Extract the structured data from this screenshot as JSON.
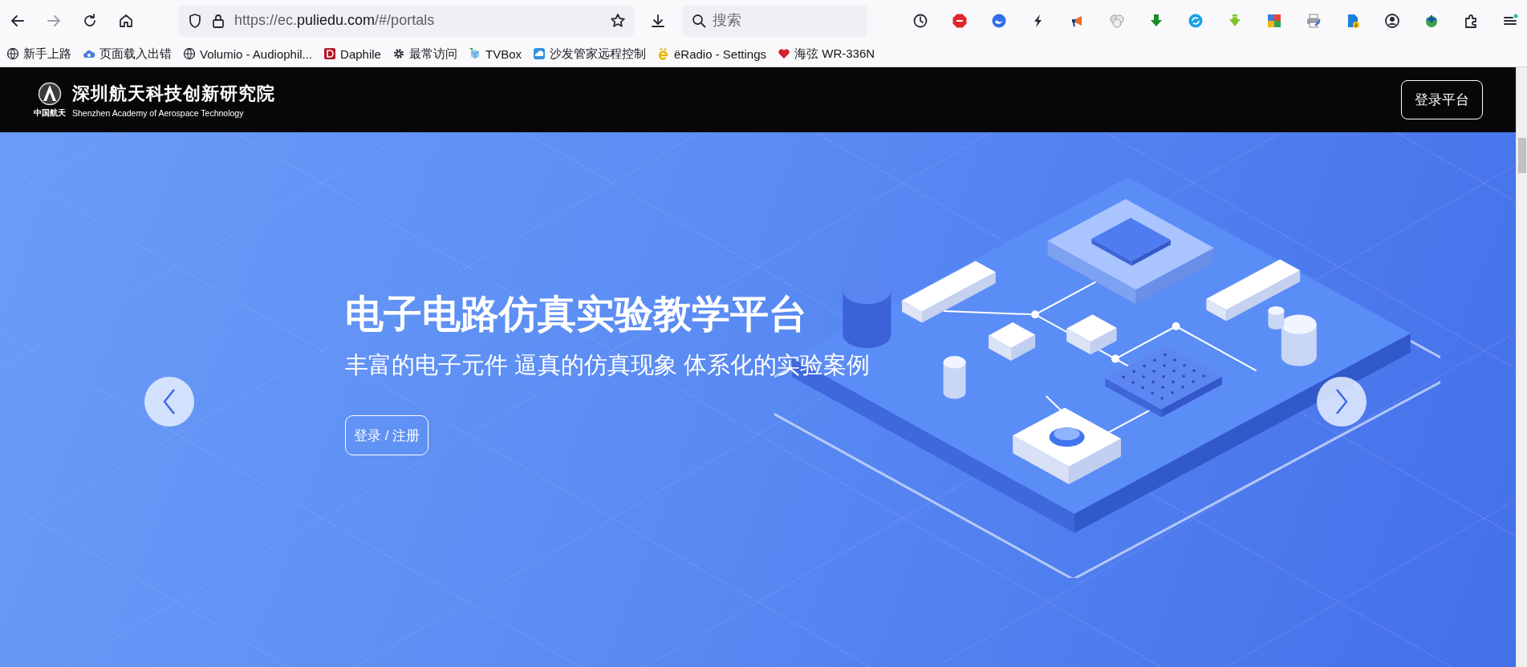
{
  "browser": {
    "url": {
      "scheme_host": "https://ec.",
      "domain": "puliedu.com",
      "path": "/#/portals"
    },
    "search": {
      "placeholder": "搜索"
    },
    "bookmarks": [
      {
        "label": "新手上路",
        "kind": "globe"
      },
      {
        "label": "页面载入出错",
        "kind": "cloud"
      },
      {
        "label": "Volumio - Audiophil...",
        "kind": "globe"
      },
      {
        "label": "Daphile",
        "kind": "badge"
      },
      {
        "label": "最常访问",
        "kind": "gear"
      },
      {
        "label": "TVBox",
        "kind": "cube"
      },
      {
        "label": "沙发管家远程控制",
        "kind": "app"
      },
      {
        "label": "ëRadio - Settings",
        "kind": "letter"
      },
      {
        "label": "海弦 WR-336N",
        "kind": "heart"
      }
    ]
  },
  "site_header": {
    "logo_caption": "中国航天",
    "title": "深圳航天科技创新研究院",
    "subtitle": "Shenzhen Academy of Aerospace Technology",
    "login_button": "登录平台"
  },
  "hero": {
    "title": "电子电路仿真实验教学平台",
    "subtitle": "丰富的电子元件 逼真的仿真现象 体系化的实验案例",
    "button": "登录 / 注册"
  }
}
